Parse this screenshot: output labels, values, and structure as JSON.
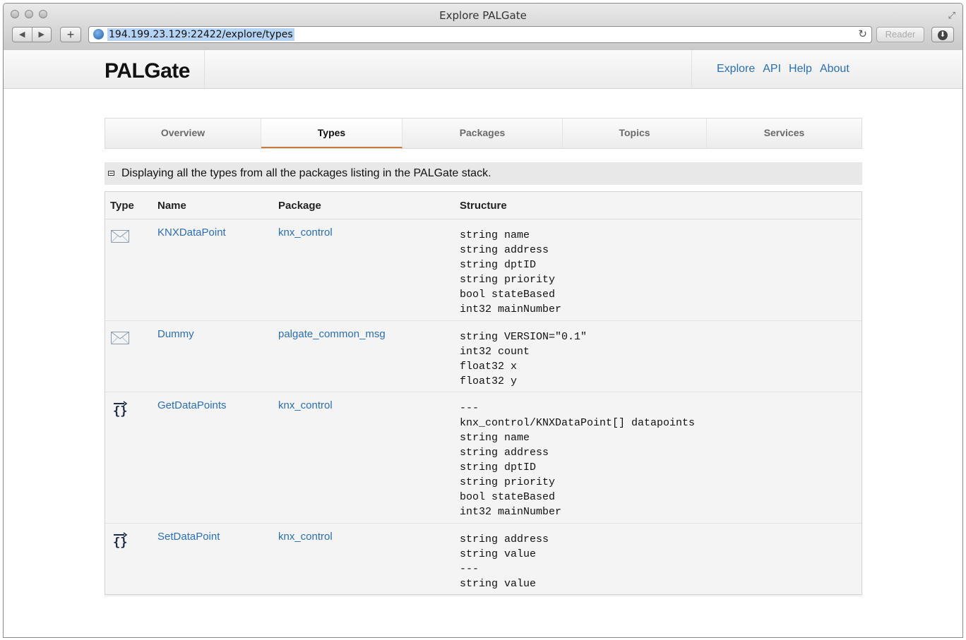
{
  "browser": {
    "window_title": "Explore PALGate",
    "url": "194.199.23.129:22422/explore/types",
    "reader_label": "Reader",
    "back_glyph": "◀",
    "forward_glyph": "▶",
    "add_glyph": "+",
    "reload_glyph": "↻"
  },
  "site": {
    "brand": "PALGate",
    "nav": [
      "Explore",
      "API",
      "Help",
      "About"
    ]
  },
  "tabs": [
    "Overview",
    "Types",
    "Packages",
    "Topics",
    "Services"
  ],
  "active_tab": "Types",
  "info_text": "Displaying all the types from all the packages listing in the PALGate stack.",
  "table": {
    "headers": {
      "type": "Type",
      "name": "Name",
      "package": "Package",
      "structure": "Structure"
    },
    "rows": [
      {
        "type_icon": "envelope-icon",
        "name": "KNXDataPoint",
        "package": "knx_control",
        "structure": "string name\nstring address\nstring dptID\nstring priority\nbool stateBased\nint32 mainNumber"
      },
      {
        "type_icon": "envelope-icon",
        "name": "Dummy",
        "package": "palgate_common_msg",
        "structure": "string VERSION=\"0.1\"\nint32 count\nfloat32 x\nfloat32 y"
      },
      {
        "type_icon": "service-icon",
        "name": "GetDataPoints",
        "package": "knx_control",
        "structure": "---\nknx_control/KNXDataPoint[] datapoints\nstring name\nstring address\nstring dptID\nstring priority\nbool stateBased\nint32 mainNumber"
      },
      {
        "type_icon": "service-icon",
        "name": "SetDataPoint",
        "package": "knx_control",
        "structure": "string address\nstring value\n---\nstring value"
      }
    ]
  }
}
